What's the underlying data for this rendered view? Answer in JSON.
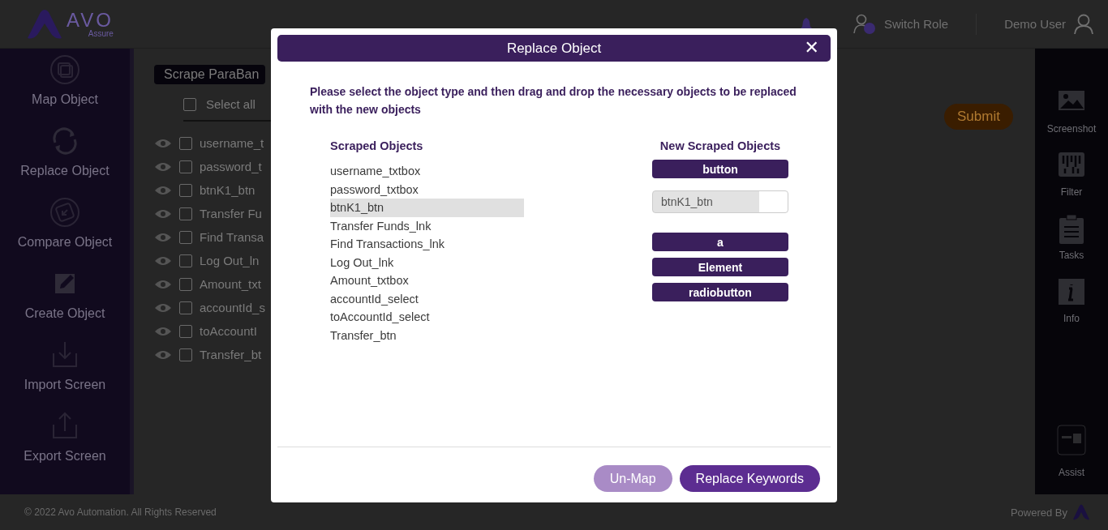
{
  "header": {
    "logo": {
      "name": "AVO",
      "tagline": "Assure"
    },
    "switch_role": "Switch Role",
    "user": "Demo User"
  },
  "left_nav": [
    "Map Object",
    "Replace Object",
    "Compare Object",
    "Create Object",
    "Import Screen",
    "Export Screen"
  ],
  "screen_title": "Scrape ParaBan",
  "select_all": {
    "label": "Select all",
    "checked": false
  },
  "objects": [
    {
      "name": "username_t",
      "checked": false
    },
    {
      "name": "password_t",
      "checked": false
    },
    {
      "name": "btnK1_btn",
      "checked": false
    },
    {
      "name": "Transfer Fu",
      "checked": false
    },
    {
      "name": "Find Transa",
      "checked": false
    },
    {
      "name": "Log Out_ln",
      "checked": false
    },
    {
      "name": "Amount_txt",
      "checked": false
    },
    {
      "name": "accountId_s",
      "checked": false
    },
    {
      "name": "toAccountI",
      "checked": false
    },
    {
      "name": "Transfer_bt",
      "checked": false
    }
  ],
  "submit": "Submit",
  "right_nav": [
    "Screenshot",
    "Filter",
    "Tasks",
    "Info",
    "Assist"
  ],
  "footer": {
    "copyright": "© 2022 Avo Automation. All Rights Reserved",
    "powered_by": "Powered By"
  },
  "dialog": {
    "title": "Replace Object",
    "close": "✕",
    "instruction": "Please select the object type and then drag and drop the necessary objects to be replaced with the new objects",
    "scraped_heading": "Scraped Objects",
    "scraped": [
      {
        "label": "username_txtbox",
        "selected": false
      },
      {
        "label": "password_txtbox",
        "selected": false
      },
      {
        "label": "btnK1_btn",
        "selected": true
      },
      {
        "label": "Transfer Funds_lnk",
        "selected": false
      },
      {
        "label": "Find Transactions_lnk",
        "selected": false
      },
      {
        "label": "Log Out_lnk",
        "selected": false
      },
      {
        "label": "Amount_txtbox",
        "selected": false
      },
      {
        "label": "accountId_select",
        "selected": false
      },
      {
        "label": "toAccountId_select",
        "selected": false
      },
      {
        "label": "Transfer_btn",
        "selected": false
      }
    ],
    "new_heading": "New Scraped Objects",
    "new_items": [
      {
        "kind": "type",
        "label": "button"
      },
      {
        "kind": "field",
        "value": "btnK1_btn"
      },
      {
        "kind": "type",
        "label": "a"
      },
      {
        "kind": "type",
        "label": "Element"
      },
      {
        "kind": "type",
        "label": "radiobutton"
      }
    ],
    "buttons": [
      {
        "kind": "secondary",
        "label": "Un-Map"
      },
      {
        "kind": "primary",
        "label": "Replace Keywords"
      }
    ]
  }
}
